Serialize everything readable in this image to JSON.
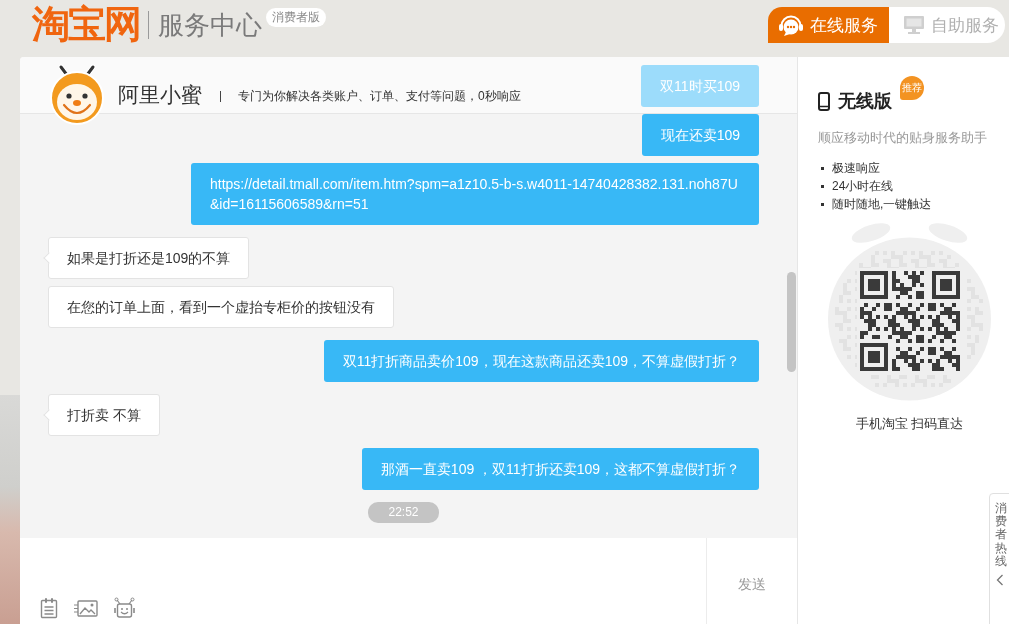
{
  "header": {
    "logo": "淘宝网",
    "title": "服务中心",
    "edition_badge": "消费者版",
    "tabs": [
      {
        "label": "在线服务",
        "selected": true
      },
      {
        "label": "自助服务",
        "selected": false
      }
    ]
  },
  "chat": {
    "agent_name": "阿里小蜜",
    "tagline": "专门为你解决各类账户、订单、支付等问题，0秒响应",
    "messages": [
      {
        "kind": "sent",
        "text": "双11时买109"
      },
      {
        "kind": "sent",
        "text": "现在还卖109"
      },
      {
        "kind": "sent",
        "text": "https://detail.tmall.com/item.htm?spm=a1z10.5-b-s.w4011-14740428382.131.noh87U&id=16115606589&rn=51"
      },
      {
        "kind": "received",
        "text": "如果是打折还是109的不算"
      },
      {
        "kind": "received",
        "text": "在您的订单上面，看到一个虚抬专柜价的按钮没有"
      },
      {
        "kind": "sent",
        "text": "双11打折商品卖价109，现在这款商品还卖109，不算虚假打折？"
      },
      {
        "kind": "received",
        "text": "打折卖 不算"
      },
      {
        "kind": "sent",
        "text": "那酒一直卖109 ，双11打折还卖109，这都不算虚假打折？"
      },
      {
        "kind": "time",
        "text": "22:52"
      }
    ],
    "send_button": "发送"
  },
  "side_panel": {
    "title": "无线版",
    "badge": "推荐",
    "subtitle": "顺应移动时代的贴身服务助手",
    "features": [
      "极速响应",
      "24小时在线",
      "随时随地,一键触达"
    ],
    "qr_caption": "手机淘宝 扫码直达"
  },
  "hotline_tab": "消费者热线"
}
